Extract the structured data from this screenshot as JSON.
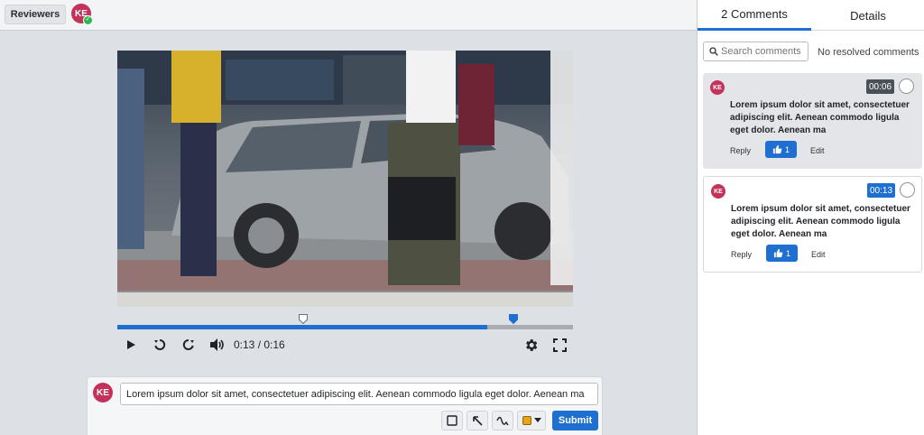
{
  "topbar": {
    "reviewers_label": "Reviewers",
    "avatar_initials": "KE"
  },
  "player": {
    "time_display": "0:13 / 0:16",
    "progress": 0.8125,
    "marker_times": [
      "00:06",
      "00:13"
    ]
  },
  "composer": {
    "avatar_initials": "KE",
    "comment_text": "Lorem ipsum dolor sit amet, consectetuer adipiscing elit. Aenean commodo ligula eget dolor. Aenean ma",
    "submit_label": "Submit",
    "annotation_color": "#e8a317"
  },
  "sidebar": {
    "tabs": [
      {
        "label": "2 Comments",
        "active": true
      },
      {
        "label": "Details",
        "active": false
      }
    ],
    "search_placeholder": "Search comments",
    "resolved_label": "No resolved comments",
    "comments": [
      {
        "avatar_initials": "KE",
        "timestamp": "00:06",
        "text": "Lorem ipsum dolor sit amet, consectetuer adipiscing elit. Aenean commodo ligula eget dolor. Aenean ma",
        "reply_label": "Reply",
        "like_count": "1",
        "edit_label": "Edit",
        "timestamp_color": "#4a5058"
      },
      {
        "avatar_initials": "KE",
        "timestamp": "00:13",
        "text": "Lorem ipsum dolor sit amet, consectetuer adipiscing elit. Aenean commodo ligula eget dolor. Aenean ma",
        "reply_label": "Reply",
        "like_count": "1",
        "edit_label": "Edit",
        "timestamp_color": "#1f6fd1"
      }
    ]
  },
  "colors": {
    "accent": "#1f6fd1",
    "avatar": "#c2325a",
    "presence": "#2db84d"
  }
}
